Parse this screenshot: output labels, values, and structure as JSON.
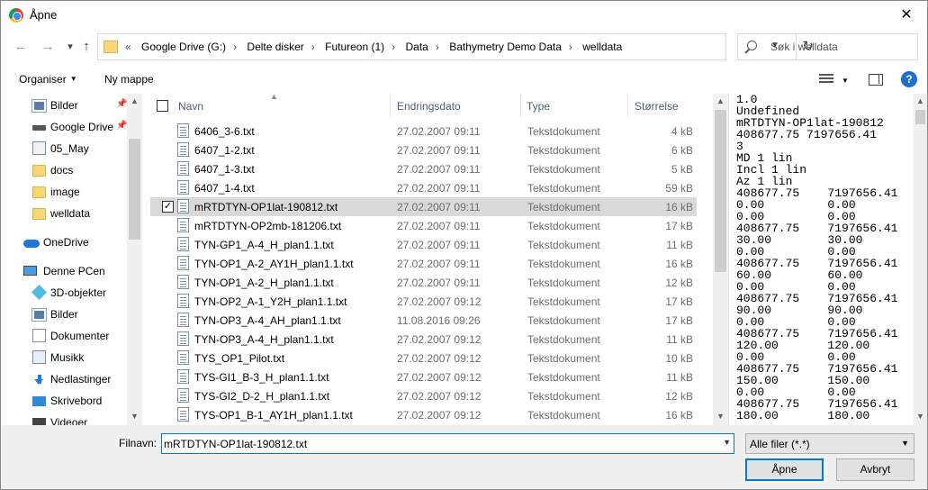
{
  "window": {
    "title": "Åpne",
    "close": "✕"
  },
  "nav": {
    "back": "←",
    "forward": "→",
    "up": "↑",
    "refresh": "↻",
    "breadcrumb_prefix": "«",
    "breadcrumbs": [
      "Google Drive (G:)",
      "Delte disker",
      "Futureon (1)",
      "Data",
      "Bathymetry Demo Data",
      "welldata"
    ],
    "search_placeholder": "Søk i welldata"
  },
  "toolbar": {
    "organize": "Organiser",
    "new_folder": "Ny mappe",
    "help": "?"
  },
  "sidebar": {
    "items": [
      {
        "label": "Bilder",
        "icon": "pictures-icon",
        "pinned": true
      },
      {
        "label": "Google Drive",
        "icon": "drive-icon",
        "pinned": true
      },
      {
        "label": "05_May",
        "icon": "folder-icon",
        "pinned": false
      },
      {
        "label": "docs",
        "icon": "folder-icon",
        "pinned": false
      },
      {
        "label": "image",
        "icon": "folder-icon",
        "pinned": false
      },
      {
        "label": "welldata",
        "icon": "folder-icon",
        "pinned": false
      },
      {
        "label": "OneDrive",
        "icon": "onedrive-icon",
        "pinned": false
      },
      {
        "label": "Denne PCen",
        "icon": "computer-icon",
        "pinned": false
      },
      {
        "label": "3D-objekter",
        "icon": "3d-objects-icon",
        "pinned": false
      },
      {
        "label": "Bilder",
        "icon": "pictures-icon",
        "pinned": false
      },
      {
        "label": "Dokumenter",
        "icon": "documents-icon",
        "pinned": false
      },
      {
        "label": "Musikk",
        "icon": "music-icon",
        "pinned": false
      },
      {
        "label": "Nedlastinger",
        "icon": "downloads-icon",
        "pinned": false
      },
      {
        "label": "Skrivebord",
        "icon": "desktop-icon",
        "pinned": false
      },
      {
        "label": "Videoer",
        "icon": "videos-icon",
        "pinned": false
      }
    ]
  },
  "columns": {
    "name": "Navn",
    "date": "Endringsdato",
    "type": "Type",
    "size": "Størrelse"
  },
  "files": [
    {
      "name": "6406_3-6.txt",
      "date": "27.02.2007 09:11",
      "type": "Tekstdokument",
      "size": "4 kB",
      "selected": false
    },
    {
      "name": "6407_1-2.txt",
      "date": "27.02.2007 09:11",
      "type": "Tekstdokument",
      "size": "6 kB",
      "selected": false
    },
    {
      "name": "6407_1-3.txt",
      "date": "27.02.2007 09:11",
      "type": "Tekstdokument",
      "size": "5 kB",
      "selected": false
    },
    {
      "name": "6407_1-4.txt",
      "date": "27.02.2007 09:11",
      "type": "Tekstdokument",
      "size": "59 kB",
      "selected": false
    },
    {
      "name": "mRTDTYN-OP1lat-190812.txt",
      "date": "27.02.2007 09:11",
      "type": "Tekstdokument",
      "size": "16 kB",
      "selected": true
    },
    {
      "name": "mRTDTYN-OP2mb-181206.txt",
      "date": "27.02.2007 09:11",
      "type": "Tekstdokument",
      "size": "17 kB",
      "selected": false
    },
    {
      "name": "TYN-GP1_A-4_H_plan1.1.txt",
      "date": "27.02.2007 09:11",
      "type": "Tekstdokument",
      "size": "11 kB",
      "selected": false
    },
    {
      "name": "TYN-OP1_A-2_AY1H_plan1.1.txt",
      "date": "27.02.2007 09:11",
      "type": "Tekstdokument",
      "size": "16 kB",
      "selected": false
    },
    {
      "name": "TYN-OP1_A-2_H_plan1.1.txt",
      "date": "27.02.2007 09:11",
      "type": "Tekstdokument",
      "size": "12 kB",
      "selected": false
    },
    {
      "name": "TYN-OP2_A-1_Y2H_plan1.1.txt",
      "date": "27.02.2007 09:12",
      "type": "Tekstdokument",
      "size": "17 kB",
      "selected": false
    },
    {
      "name": "TYN-OP3_A-4_AH_plan1.1.txt",
      "date": "11.08.2016 09:26",
      "type": "Tekstdokument",
      "size": "17 kB",
      "selected": false
    },
    {
      "name": "TYN-OP3_A-4_H_plan1.1.txt",
      "date": "27.02.2007 09:12",
      "type": "Tekstdokument",
      "size": "11 kB",
      "selected": false
    },
    {
      "name": "TYS_OP1_Pilot.txt",
      "date": "27.02.2007 09:12",
      "type": "Tekstdokument",
      "size": "10 kB",
      "selected": false
    },
    {
      "name": "TYS-GI1_B-3_H_plan1.1.txt",
      "date": "27.02.2007 09:12",
      "type": "Tekstdokument",
      "size": "11 kB",
      "selected": false
    },
    {
      "name": "TYS-GI2_D-2_H_plan1.1.txt",
      "date": "27.02.2007 09:12",
      "type": "Tekstdokument",
      "size": "12 kB",
      "selected": false
    },
    {
      "name": "TYS-OP1_B-1_AY1H_plan1.1.txt",
      "date": "27.02.2007 09:12",
      "type": "Tekstdokument",
      "size": "16 kB",
      "selected": false
    }
  ],
  "preview": {
    "lines": [
      "1.0",
      "Undefined",
      "mRTDTYN-OP1lat-190812",
      "408677.75 7197656.41",
      "3",
      "MD 1 lin",
      "Incl 1 lin",
      "Az 1 lin",
      "408677.75    7197656.41",
      "0.00         0.00",
      "0.00         0.00",
      "408677.75    7197656.41",
      "30.00        30.00",
      "0.00         0.00",
      "408677.75    7197656.41",
      "60.00        60.00",
      "0.00         0.00",
      "408677.75    7197656.41",
      "90.00        90.00",
      "0.00         0.00",
      "408677.75    7197656.41",
      "120.00       120.00",
      "0.00         0.00",
      "408677.75    7197656.41",
      "150.00       150.00",
      "0.00         0.00",
      "408677.75    7197656.41",
      "180.00       180.00"
    ]
  },
  "footer": {
    "filename_label": "Filnavn:",
    "filename_value": "mRTDTYN-OP1lat-190812.txt",
    "filetype": "Alle filer (*.*)",
    "open": "Åpne",
    "cancel": "Avbryt"
  }
}
